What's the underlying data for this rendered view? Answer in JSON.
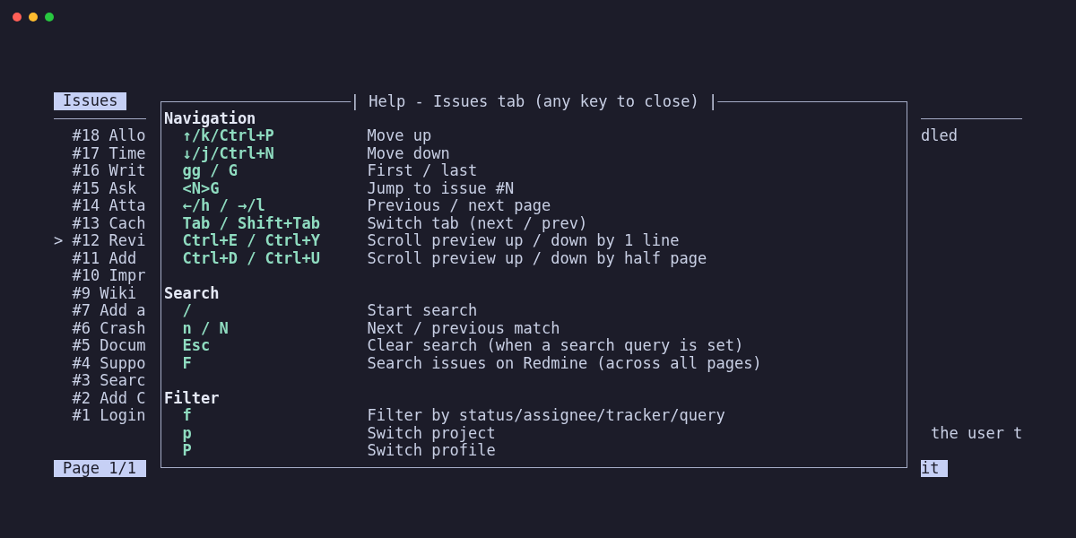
{
  "issues_pane": {
    "tab": {
      "label": "Issues",
      "selected": true
    },
    "selection_marker": ">",
    "rows": [
      {
        "label": "#18 Allo",
        "selected": false
      },
      {
        "label": "#17 Time",
        "selected": false
      },
      {
        "label": "#16 Writ",
        "selected": false
      },
      {
        "label": "#15 Ask",
        "selected": false
      },
      {
        "label": "#14 Atta",
        "selected": false
      },
      {
        "label": "#13 Cach",
        "selected": false
      },
      {
        "label": "#12 Revi",
        "selected": true
      },
      {
        "label": "#11 Add",
        "selected": false
      },
      {
        "label": "#10 Impr",
        "selected": false
      },
      {
        "label": "#9 Wiki",
        "selected": false
      },
      {
        "label": "#7 Add a",
        "selected": false
      },
      {
        "label": "#6 Crash",
        "selected": false
      },
      {
        "label": "#5 Docum",
        "selected": false
      },
      {
        "label": "#4 Suppo",
        "selected": false
      },
      {
        "label": "#3 Searc",
        "selected": false
      },
      {
        "label": "#2 Add C",
        "selected": false
      },
      {
        "label": "#1 Login",
        "selected": false
      }
    ],
    "status": "Page 1/1"
  },
  "help_dialog": {
    "title": "| Help - Issues tab (any key to close) |",
    "sections": [
      {
        "heading": "Navigation",
        "items": [
          {
            "keys": "↑/k/Ctrl+P",
            "description": "Move up"
          },
          {
            "keys": "↓/j/Ctrl+N",
            "description": "Move down"
          },
          {
            "keys": "gg / G",
            "description": "First / last"
          },
          {
            "keys": "<N>G",
            "description": "Jump to issue #N"
          },
          {
            "keys": "←/h / →/l",
            "description": "Previous / next page"
          },
          {
            "keys": "Tab / Shift+Tab",
            "description": "Switch tab (next / prev)"
          },
          {
            "keys": "Ctrl+E / Ctrl+Y",
            "description": "Scroll preview up / down by 1 line"
          },
          {
            "keys": "Ctrl+D / Ctrl+U",
            "description": "Scroll preview up / down by half page"
          }
        ]
      },
      {
        "heading": "Search",
        "items": [
          {
            "keys": "/",
            "description": "Start search"
          },
          {
            "keys": "n / N",
            "description": "Next / previous match"
          },
          {
            "keys": "Esc",
            "description": "Clear search (when a search query is set)"
          },
          {
            "keys": "F",
            "description": "Search issues on Redmine (across all pages)"
          }
        ]
      },
      {
        "heading": "Filter",
        "items": [
          {
            "keys": "f",
            "description": "Filter by status/assignee/tracker/query"
          },
          {
            "keys": "p",
            "description": "Switch project"
          },
          {
            "keys": "P",
            "description": "Switch profile"
          }
        ]
      }
    ]
  },
  "preview_pane": {
    "top_text": "dled",
    "lower_text": "the user t",
    "status": "it"
  }
}
